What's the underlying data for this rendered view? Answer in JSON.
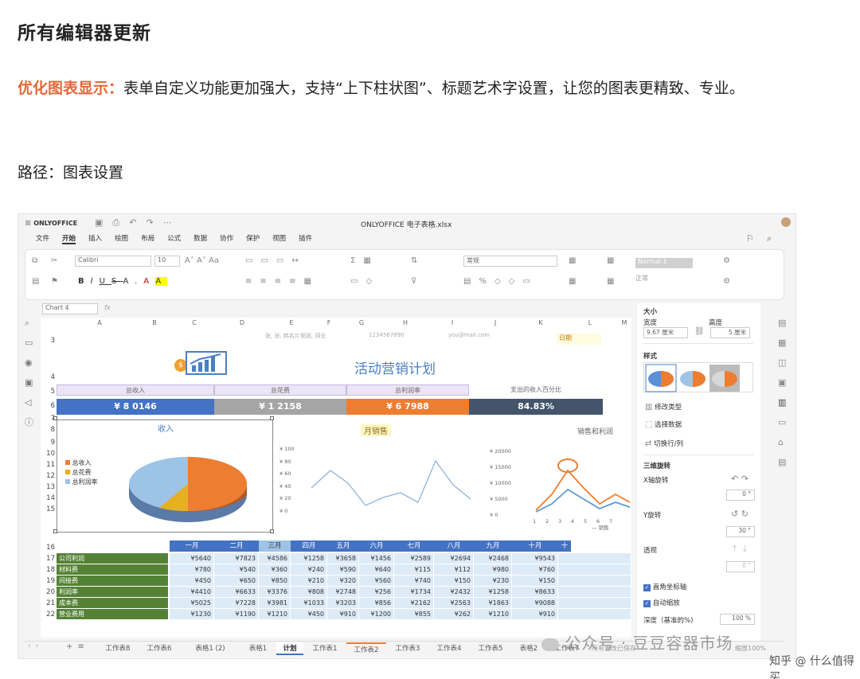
{
  "article": {
    "heading": "所有编辑器更新",
    "highlight": "优化图表显示：",
    "text": "表单自定义功能更加强大，支持“上下柱状图”、标题艺术字设置，让您的图表更精致、专业。",
    "path": "路径：图表设置"
  },
  "app": {
    "logo": "ONLYOFFICE",
    "title": "ONLYOFFICE 电子表格.xlsx",
    "menu": [
      "文件",
      "开始",
      "插入",
      "绘图",
      "布局",
      "公式",
      "数据",
      "协作",
      "保护",
      "视图",
      "插件"
    ],
    "active_menu": "开始",
    "font_name": "Calibri",
    "font_size": "10",
    "num_format": "常规",
    "style_name": "Normal 1",
    "style_name2": "正常",
    "cell_ref": "Chart 4",
    "fx": "fx"
  },
  "sheet": {
    "columns": [
      "A",
      "B",
      "C",
      "D",
      "E",
      "F",
      "G",
      "H",
      "I",
      "J",
      "K",
      "L",
      "M"
    ],
    "rows": [
      "3",
      "4",
      "5",
      "6",
      "7",
      "8",
      "9",
      "10",
      "11",
      "12",
      "13",
      "14",
      "15",
      "16",
      "17",
      "18",
      "19",
      "20",
      "21",
      "22"
    ],
    "top_text1": "张, 张, 韩名片规则, 洞业",
    "top_text2": "1234567890",
    "top_text3": "you@mail.com",
    "top_date": "日期",
    "title": "活动营销计划",
    "kpi_labels": [
      "总收入",
      "总花费",
      "总利润率",
      "支出的收入百分比"
    ],
    "kpi_values": [
      "¥ 8 0146",
      "¥ 1 2158",
      "¥ 6 7988",
      "84.83%"
    ],
    "pie_title": "收入",
    "pie_legend": [
      "总收入",
      "总花费",
      "总利润率"
    ],
    "line_title": "月销售",
    "line_yticks": [
      "¥ 100",
      "¥ 80",
      "¥ 60",
      "¥ 40",
      "¥ 20",
      "¥ 0"
    ],
    "right_title": "销售和利润",
    "right_yticks": [
      "¥ 20000",
      "¥ 15000",
      "¥ 10000",
      "¥ 5000",
      "¥ 0"
    ],
    "right_xticks": [
      "1",
      "2",
      "3",
      "4",
      "5",
      "6",
      "7"
    ],
    "right_legend": "销售",
    "months": [
      "一月",
      "二月",
      "三月",
      "四月",
      "五月",
      "六月",
      "七月",
      "八月",
      "九月",
      "十月",
      "十"
    ],
    "table_rows": [
      {
        "label": "公司利润",
        "values": [
          "¥5640",
          "¥7823",
          "¥4586",
          "¥1258",
          "¥3658",
          "¥1456",
          "¥2589",
          "¥2694",
          "¥2468",
          "¥9543"
        ]
      },
      {
        "label": "材料费",
        "values": [
          "¥780",
          "¥540",
          "¥360",
          "¥240",
          "¥590",
          "¥640",
          "¥115",
          "¥112",
          "¥980",
          "¥760"
        ]
      },
      {
        "label": "间接费",
        "values": [
          "¥450",
          "¥650",
          "¥850",
          "¥210",
          "¥320",
          "¥560",
          "¥740",
          "¥150",
          "¥230",
          "¥150"
        ]
      },
      {
        "label": "利润率",
        "values": [
          "¥4410",
          "¥6633",
          "¥3376",
          "¥808",
          "¥2748",
          "¥256",
          "¥1734",
          "¥2432",
          "¥1258",
          "¥8633"
        ]
      },
      {
        "label": "成本费",
        "values": [
          "¥5025",
          "¥7228",
          "¥3981",
          "¥1033",
          "¥3203",
          "¥856",
          "¥2162",
          "¥2563",
          "¥1863",
          "¥9088"
        ]
      },
      {
        "label": "营业费用",
        "values": [
          "¥1230",
          "¥1190",
          "¥1210",
          "¥450",
          "¥910",
          "¥1200",
          "¥855",
          "¥262",
          "¥1210",
          "¥910"
        ]
      }
    ]
  },
  "panel": {
    "size_title": "大小",
    "width_label": "宽度",
    "height_label": "高度",
    "width_value": "9.67 厘米",
    "height_value": "5 厘米",
    "style_title": "样式",
    "change_type": "修改类型",
    "select_data": "选择数据",
    "switch_rowcol": "切换行/列",
    "rot_title": "三维旋转",
    "x_rot": "X轴旋转",
    "x_val": "0 °",
    "y_rot": "Y旋转",
    "y_val": "30 °",
    "persp": "透视",
    "persp_val": "0 °",
    "right_axes": "直角坐标轴",
    "autoscale": "自动缩放",
    "depth_label": "深度（基准的%)",
    "depth_value": "100 %"
  },
  "tabs": [
    "工作表8",
    "工作表6",
    "表格1 (2)",
    "表格1",
    "计划",
    "工作表1",
    "工作表2",
    "工作表3",
    "工作表4",
    "工作表5",
    "表格2",
    "工作表7"
  ],
  "active_tab": "计划",
  "status": "所有更改已保存",
  "zoom": "缩放100%",
  "watermark": "公众号 · 豆豆容器市场",
  "watermark2": "知乎 @ 什么值得买",
  "colors": {
    "accent": "#e2683a",
    "blue": "#4472c4",
    "gray": "#a5a5a5",
    "orange": "#ed7d31",
    "navy": "#44546a",
    "green": "#548235"
  }
}
